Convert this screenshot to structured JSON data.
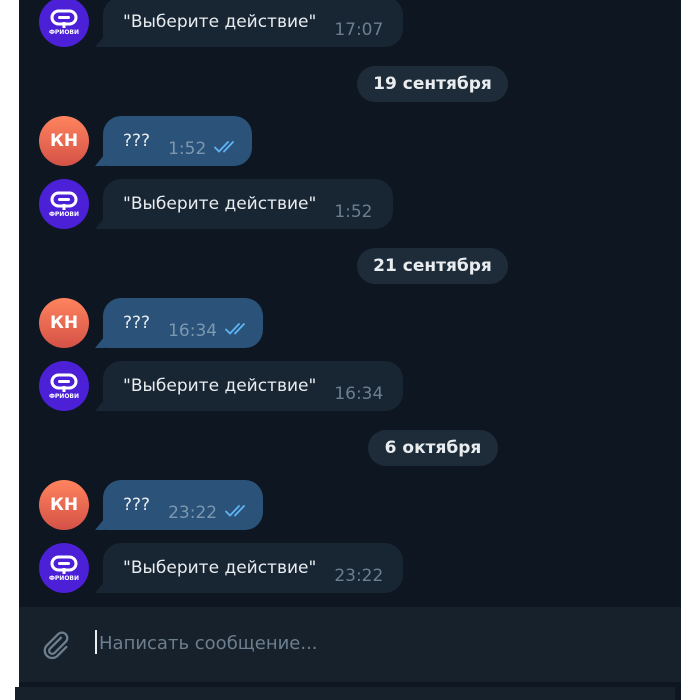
{
  "colors": {
    "chat_background": "#0e1621",
    "outgoing_bubble": "#2b5278",
    "incoming_bubble": "#182533",
    "date_pill": "#1e2c3a",
    "read_check": "#5eb5f7",
    "user_avatar": "#e4704f",
    "bot_avatar": "#4b20d6"
  },
  "user": {
    "initials": "КН"
  },
  "bot": {
    "brand": "ФРИОВИ",
    "icon": "bot-logo-icon"
  },
  "messages": [
    {
      "type": "in",
      "text": "\"Выберите действие\"",
      "time": "17:07"
    },
    {
      "type": "date",
      "text": "19 сентября"
    },
    {
      "type": "out",
      "text": "???",
      "time": "1:52",
      "status": "read"
    },
    {
      "type": "in",
      "text": "\"Выберите действие\"",
      "time": "1:52"
    },
    {
      "type": "date",
      "text": "21 сентября"
    },
    {
      "type": "out",
      "text": "???",
      "time": "16:34",
      "status": "read"
    },
    {
      "type": "in",
      "text": "\"Выберите действие\"",
      "time": "16:34"
    },
    {
      "type": "date",
      "text": "6 октября"
    },
    {
      "type": "out",
      "text": "???",
      "time": "23:22",
      "status": "read"
    },
    {
      "type": "in",
      "text": "\"Выберите действие\"",
      "time": "23:22"
    }
  ],
  "composer": {
    "placeholder": "Написать сообщение...",
    "attach_icon": "paperclip-icon"
  }
}
